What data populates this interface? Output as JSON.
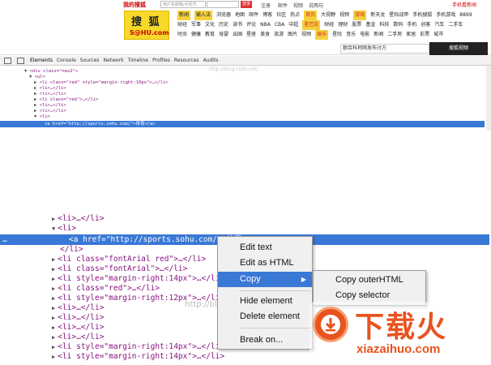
{
  "sohu": {
    "top_brand": "我的搜狐",
    "search_placeholder": "用户名邮箱/手机号",
    "go_label": "登录",
    "top_links": [
      "注册",
      "邮件",
      "视频",
      "说两句"
    ],
    "top_right": "手机看新闻",
    "logo_cn": "搜 狐",
    "logo_en": "S@HU.com",
    "nav_rows": [
      [
        "新闻",
        "输入法",
        "浏览器",
        "地图",
        "邮件",
        "博客",
        "社区",
        "热点",
        "首页",
        "大视野",
        "视频",
        "游戏",
        "新天龙",
        "星际战甲",
        "手机搜狐",
        "手机游戏",
        "8899"
      ],
      [
        "财经",
        "军事",
        "文化",
        "历史",
        "读书",
        "评论",
        "NBA",
        "CBA",
        "中超",
        "星巴克",
        "财经",
        "理财",
        "股票",
        "基金",
        "科技",
        "数码",
        "手机",
        "创客",
        "汽车",
        "二手车"
      ],
      [
        "时尚",
        "健康",
        "教育",
        "母婴",
        "出国",
        "星座",
        "美食",
        "旅游",
        "图片",
        "视频",
        "娱乐",
        "星际",
        "音乐",
        "电影",
        "新闻",
        "二手房",
        "家居",
        "彩票",
        "城市"
      ]
    ],
    "ad_text": "额百科珂网发布讨方",
    "ad_image_text": "搜狐视频"
  },
  "devtools": {
    "tabs": [
      "Elements",
      "Console",
      "Sources",
      "Network",
      "Timeline",
      "Profiles",
      "Resources",
      "Audits"
    ],
    "small_tree": [
      "<div class=\"nav2\">",
      "<ul>",
      "<li class=\"red\" style=\"margin-right:10px\">…</li>",
      "<li>…</li>",
      "<li>…</li>",
      "<li class=\"red\">…</li>",
      "<li>…</li>",
      "<li>…</li>",
      "<li>"
    ],
    "small_selected": "<a href=\"http://sports.sohu.com/\">体育</a>",
    "watermark": "http://blog.csdn.net/"
  },
  "tree": {
    "rows": [
      {
        "tag": "<li>…</li>"
      },
      {
        "tag": "<li>"
      },
      {
        "tag": "</li>"
      },
      {
        "tag": "<li class=\"fontArial red\">…</li>"
      },
      {
        "tag": "<li class=\"fontArial\">…</li>"
      },
      {
        "tag": "<li style=\"margin-right:14px\">…</li>"
      },
      {
        "tag": "<li class=\"red\">…</li>"
      },
      {
        "tag": "<li style=\"margin-right:12px\">…</li>"
      },
      {
        "tag": "<li>…</li>"
      },
      {
        "tag": "<li>…</li>"
      },
      {
        "tag": "<li>…</li>"
      },
      {
        "tag": "<li>…</li>"
      },
      {
        "tag": "<li style=\"margin-right:14px\">…</li>"
      },
      {
        "tag": "<li style=\"margin-right:14px\">…</li>"
      }
    ],
    "selected": "<a href=\"http://sports.sohu.com/\">体育</a>",
    "watermark": "http://blog.csdn.net/"
  },
  "context_menu": {
    "items": [
      "Edit text",
      "Edit as HTML",
      "Copy",
      "Hide element",
      "Delete element",
      "Break on..."
    ],
    "submenu": [
      "Copy outerHTML",
      "Copy selector"
    ]
  },
  "brand": {
    "cn": "下载火",
    "en": "xiazaihuo.com",
    "color": "#e8531f"
  }
}
